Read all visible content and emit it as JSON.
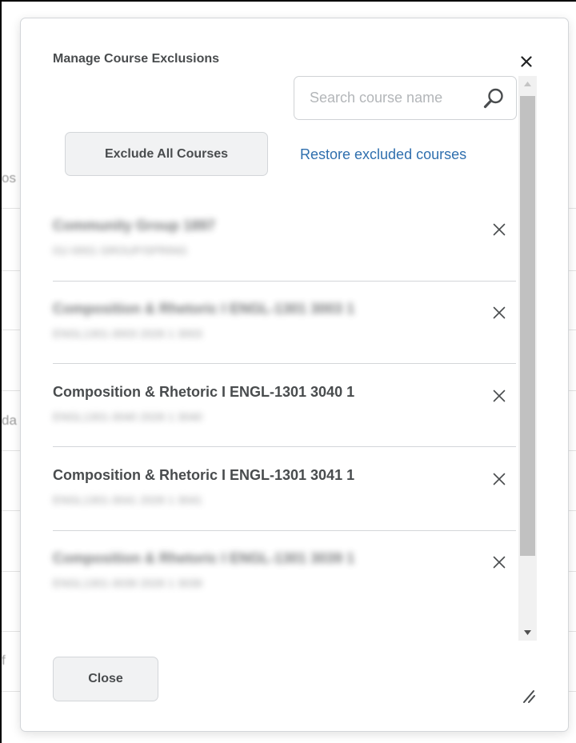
{
  "background": {
    "fragments": [
      "os",
      "da",
      "f"
    ]
  },
  "dialog": {
    "title": "Manage Course Exclusions",
    "search": {
      "placeholder": "Search course name",
      "value": ""
    },
    "exclude_all_label": "Exclude All Courses",
    "restore_label": "Restore excluded courses",
    "courses": [
      {
        "name": "Community Group 1897",
        "detail": "01/-0001 GROUP/SPRING",
        "blurred": true
      },
      {
        "name": "Composition & Rhetoric I ENGL-1301 3003 1",
        "detail": "ENGL1301-3003 2026 1 3003",
        "blurred": true
      },
      {
        "name": "Composition & Rhetoric I ENGL-1301 3040 1",
        "detail": "ENGL1301-3040 2026 1 3040",
        "blurred": false
      },
      {
        "name": "Composition & Rhetoric I ENGL-1301 3041 1",
        "detail": "ENGL1301-3041 2026 1 3041",
        "blurred": false
      },
      {
        "name": "Composition & Rhetoric I ENGL-1301 3039 1",
        "detail": "ENGL1301-3039 2026 1 3039",
        "blurred": true
      }
    ],
    "close_label": "Close"
  },
  "icons": {
    "dialog_close": "close-icon",
    "search": "search-icon",
    "row_remove": "close-icon",
    "resize": "resize-handle-icon"
  },
  "colors": {
    "link": "#2f6fae",
    "text": "#494c4e",
    "button_bg": "#f1f2f3",
    "border": "#d3d6d9"
  }
}
